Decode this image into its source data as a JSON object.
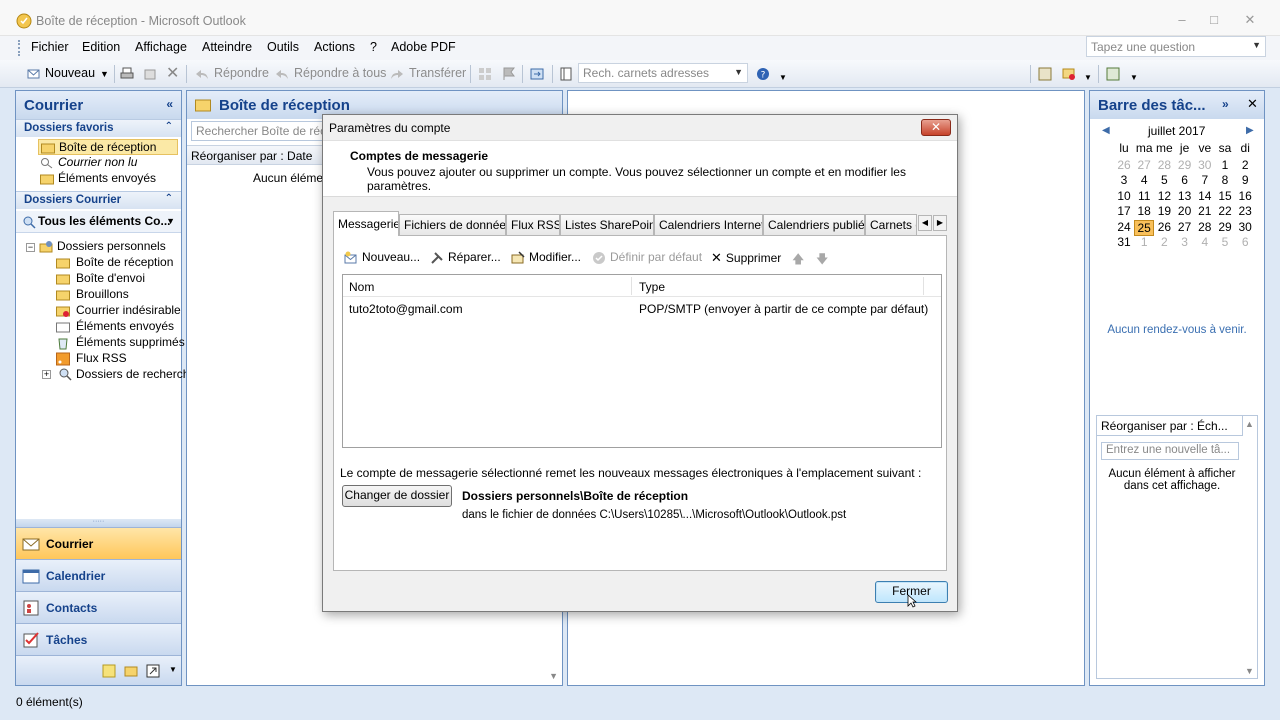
{
  "window": {
    "title": "Boîte de réception - Microsoft Outlook",
    "minimize": "–",
    "maximize": "□",
    "close": "✕"
  },
  "menu": {
    "items": [
      "Fichier",
      "Edition",
      "Affichage",
      "Atteindre",
      "Outils",
      "Actions",
      "?",
      "Adobe PDF"
    ],
    "help_placeholder": "Tapez une question"
  },
  "toolbar": {
    "new": "Nouveau",
    "reply": "Répondre",
    "reply_all": "Répondre à tous",
    "forward": "Transférer",
    "address_search": "Rech. carnets adresses"
  },
  "nav": {
    "title": "Courrier",
    "favorites_header": "Dossiers favoris",
    "favorites": [
      "Boîte de réception",
      "Courrier non lu",
      "Éléments envoyés"
    ],
    "mail_header": "Dossiers Courrier",
    "all_items": "Tous les éléments Co...",
    "personal_folders": "Dossiers personnels",
    "folders": [
      "Boîte de réception",
      "Boîte d'envoi",
      "Brouillons",
      "Courrier indésirable",
      "Éléments envoyés",
      "Éléments supprimés",
      "Flux RSS",
      "Dossiers de recherch"
    ],
    "buttons": [
      "Courrier",
      "Calendrier",
      "Contacts",
      "Tâches"
    ]
  },
  "list": {
    "title": "Boîte de réception",
    "search_placeholder": "Rechercher Boîte de récep",
    "sort": "Réorganiser par : Date",
    "empty": "Aucun élémen"
  },
  "todo": {
    "title": "Barre des tâc...",
    "month": "juillet 2017",
    "weekdays": [
      "lu",
      "ma",
      "me",
      "je",
      "ve",
      "sa",
      "di"
    ],
    "weeks": [
      [
        "26",
        "27",
        "28",
        "29",
        "30",
        "1",
        "2"
      ],
      [
        "3",
        "4",
        "5",
        "6",
        "7",
        "8",
        "9"
      ],
      [
        "10",
        "11",
        "12",
        "13",
        "14",
        "15",
        "16"
      ],
      [
        "17",
        "18",
        "19",
        "20",
        "21",
        "22",
        "23"
      ],
      [
        "24",
        "25",
        "26",
        "27",
        "28",
        "29",
        "30"
      ],
      [
        "31",
        "1",
        "2",
        "3",
        "4",
        "5",
        "6"
      ]
    ],
    "today": "25",
    "no_appointments": "Aucun rendez-vous à venir.",
    "task_sort": "Réorganiser par : Éch...",
    "task_placeholder": "Entrez une nouvelle tâ...",
    "task_empty": "Aucun élément à afficher dans cet affichage."
  },
  "status": {
    "items": "0 élément(s)"
  },
  "dialog": {
    "title": "Paramètres du compte",
    "header": "Comptes de messagerie",
    "subheader": "Vous pouvez ajouter ou supprimer un compte. Vous pouvez sélectionner un compte et en modifier les paramètres.",
    "tabs": [
      "Messagerie",
      "Fichiers de données",
      "Flux RSS",
      "Listes SharePoint",
      "Calendriers Internet",
      "Calendriers publiés",
      "Carnets d"
    ],
    "actions": {
      "new": "Nouveau...",
      "repair": "Réparer...",
      "modify": "Modifier...",
      "default": "Définir par défaut",
      "remove": "Supprimer"
    },
    "columns": {
      "name": "Nom",
      "type": "Type"
    },
    "accounts": [
      {
        "name": "tuto2toto@gmail.com",
        "type": "POP/SMTP (envoyer à partir de ce compte par défaut)"
      }
    ],
    "deliver_text": "Le compte de messagerie sélectionné remet les nouveaux messages électroniques à l'emplacement suivant :",
    "change_folder": "Changer de dossier",
    "folder": "Dossiers personnels\\Boîte de réception",
    "folder_path": "dans le fichier de données C:\\Users\\10285\\...\\Microsoft\\Outlook\\Outlook.pst",
    "close": "Fermer"
  }
}
